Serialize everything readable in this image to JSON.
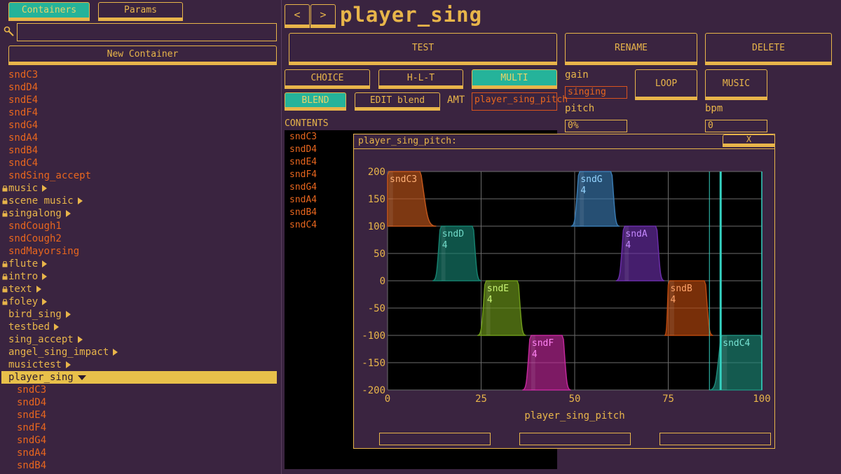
{
  "sidebar": {
    "tabs": [
      {
        "label": "Containers",
        "active": true
      },
      {
        "label": "Params",
        "active": false
      }
    ],
    "search": {
      "value": "",
      "placeholder": ""
    },
    "new_container_label": "New Container",
    "tree": [
      {
        "label": "sndC3",
        "kind": "snd"
      },
      {
        "label": "sndD4",
        "kind": "snd"
      },
      {
        "label": "sndE4",
        "kind": "snd"
      },
      {
        "label": "sndF4",
        "kind": "snd"
      },
      {
        "label": "sndG4",
        "kind": "snd"
      },
      {
        "label": "sndA4",
        "kind": "snd"
      },
      {
        "label": "sndB4",
        "kind": "snd"
      },
      {
        "label": "sndC4",
        "kind": "snd"
      },
      {
        "label": "sndSing_accept",
        "kind": "snd"
      },
      {
        "label": "music",
        "kind": "folder",
        "locked": true
      },
      {
        "label": "scene music",
        "kind": "folder",
        "locked": true
      },
      {
        "label": "singalong",
        "kind": "folder",
        "locked": true
      },
      {
        "label": "sndCough1",
        "kind": "snd"
      },
      {
        "label": "sndCough2",
        "kind": "snd"
      },
      {
        "label": "sndMayorsing",
        "kind": "snd"
      },
      {
        "label": "flute",
        "kind": "folder",
        "locked": true
      },
      {
        "label": "intro",
        "kind": "folder",
        "locked": true
      },
      {
        "label": "text",
        "kind": "folder",
        "locked": true
      },
      {
        "label": "foley",
        "kind": "folder",
        "locked": true
      },
      {
        "label": "bird_sing",
        "kind": "folder"
      },
      {
        "label": "testbed",
        "kind": "folder"
      },
      {
        "label": "sing_accept",
        "kind": "folder"
      },
      {
        "label": "angel_sing_impact",
        "kind": "folder"
      },
      {
        "label": "musictest",
        "kind": "folder"
      },
      {
        "label": "player_sing",
        "kind": "selected"
      },
      {
        "label": "sndC3",
        "kind": "child"
      },
      {
        "label": "sndD4",
        "kind": "child"
      },
      {
        "label": "sndE4",
        "kind": "child"
      },
      {
        "label": "sndF4",
        "kind": "child"
      },
      {
        "label": "sndG4",
        "kind": "child"
      },
      {
        "label": "sndA4",
        "kind": "child"
      },
      {
        "label": "sndB4",
        "kind": "child"
      }
    ]
  },
  "header": {
    "prev_label": "<",
    "next_label": ">",
    "title": "player_sing"
  },
  "actions": {
    "test": "TEST",
    "rename": "RENAME",
    "delete": "DELETE"
  },
  "modes": {
    "choice": "CHOICE",
    "hlt": "H-L-T",
    "multi": "MULTI",
    "blend": "BLEND",
    "edit_blend": "EDIT blend"
  },
  "amt": {
    "label": "AMT",
    "value": "player_sing_pitch"
  },
  "gain": {
    "label": "gain",
    "value": "singing"
  },
  "pitch": {
    "label": "pitch",
    "value": "0%"
  },
  "bpm": {
    "label": "bpm",
    "value": "0"
  },
  "loop_label": "LOOP",
  "music_label": "MUSIC",
  "contents": {
    "label": "CONTENTS",
    "items": [
      "sndC3",
      "sndD4",
      "sndE4",
      "sndF4",
      "sndG4",
      "sndA4",
      "sndB4",
      "sndC4"
    ]
  },
  "popup": {
    "title": "player_sing_pitch:",
    "close_label": "X",
    "footer_fields": [
      "",
      "",
      ""
    ]
  },
  "colors": {
    "accent": "#e8b54a",
    "sound": "#e8661e",
    "active": "#25b39a",
    "bg": "#3a2440"
  },
  "chart_data": {
    "type": "area",
    "xlabel": "player_sing_pitch",
    "ylabel": "",
    "xlim": [
      0,
      100
    ],
    "ylim": [
      -200,
      200
    ],
    "x_ticks": [
      0,
      25,
      50,
      75,
      100
    ],
    "y_ticks": [
      200,
      150,
      100,
      50,
      0,
      -50,
      -100,
      -150,
      -200
    ],
    "grid": true,
    "playhead": 89,
    "regions": [
      {
        "name": "sndC3",
        "label2": "",
        "x": [
          0,
          0,
          9,
          13
        ],
        "y_top": 200,
        "y_bot": 100,
        "color": "#c0561c"
      },
      {
        "name": "sndD",
        "label2": "4",
        "x": [
          12,
          14,
          23,
          25
        ],
        "y_top": 100,
        "y_bot": 0,
        "color": "#16806e"
      },
      {
        "name": "sndE",
        "label2": "4",
        "x": [
          24,
          26,
          35,
          37
        ],
        "y_top": 0,
        "y_bot": -100,
        "color": "#6e9a1a"
      },
      {
        "name": "sndF",
        "label2": "4",
        "x": [
          36,
          38,
          47,
          49
        ],
        "y_top": -100,
        "y_bot": -200,
        "color": "#c0289a"
      },
      {
        "name": "sndG",
        "label2": "4",
        "x": [
          49,
          51,
          60,
          62
        ],
        "y_top": 200,
        "y_bot": 100,
        "color": "#3a7ab0"
      },
      {
        "name": "sndA",
        "label2": "4",
        "x": [
          61,
          63,
          72,
          74
        ],
        "y_top": 100,
        "y_bot": 0,
        "color": "#6a2ea8"
      },
      {
        "name": "sndB",
        "label2": "4",
        "x": [
          74,
          75,
          85,
          87
        ],
        "y_top": 0,
        "y_bot": -100,
        "color": "#b8480e"
      },
      {
        "name": "sndC4",
        "label2": "",
        "x": [
          86,
          89,
          100,
          100
        ],
        "y_top": -100,
        "y_bot": -200,
        "color": "#1e8a7a"
      }
    ]
  }
}
